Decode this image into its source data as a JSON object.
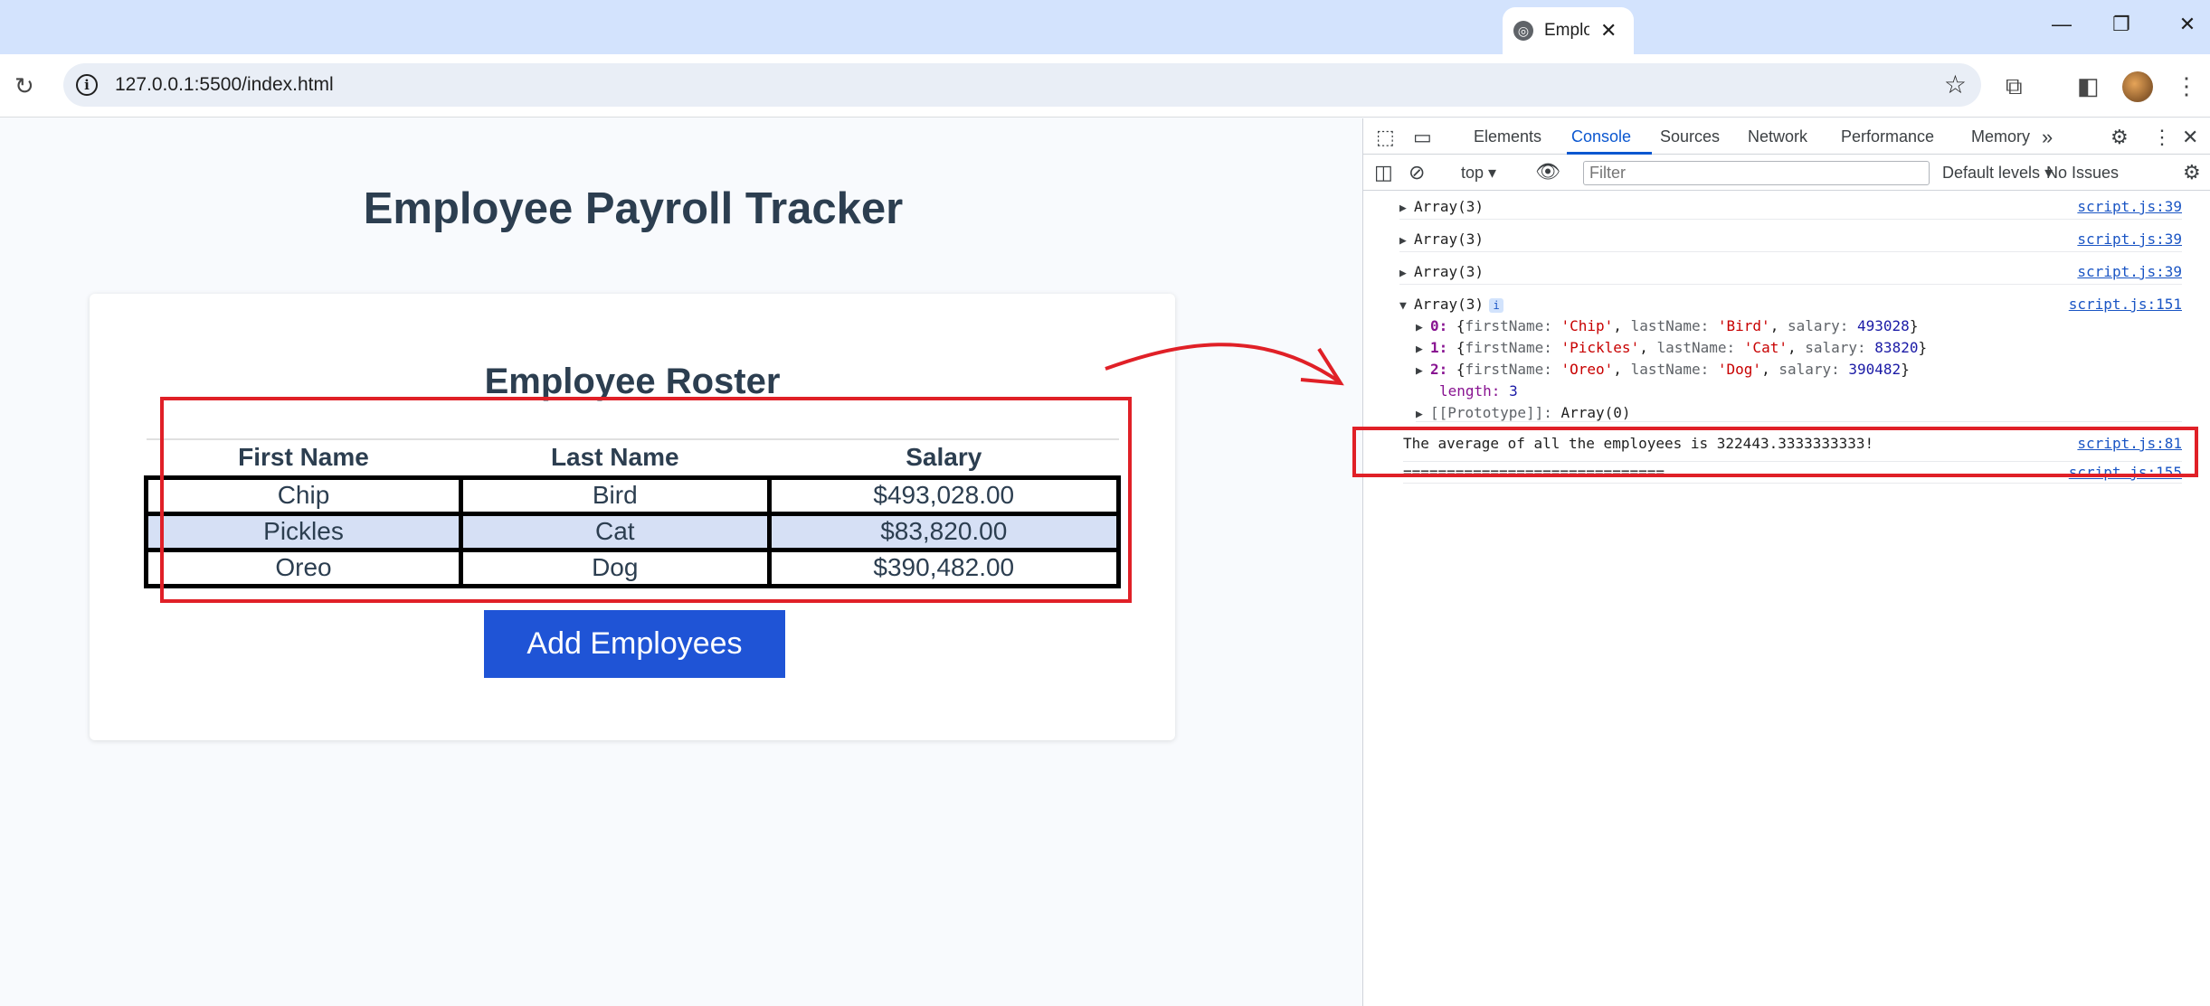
{
  "browser": {
    "tab_title": "Employee Payroll Tracker",
    "url": "127.0.0.1:5500/index.html"
  },
  "page": {
    "title": "Employee Payroll Tracker",
    "roster_title": "Employee Roster",
    "table": {
      "headers": [
        "First Name",
        "Last Name",
        "Salary"
      ],
      "rows": [
        [
          "Chip",
          "Bird",
          "$493,028.00"
        ],
        [
          "Pickles",
          "Cat",
          "$83,820.00"
        ],
        [
          "Oreo",
          "Dog",
          "$390,482.00"
        ]
      ]
    },
    "add_button_label": "Add Employees"
  },
  "devtools": {
    "tabs": [
      "Elements",
      "Console",
      "Sources",
      "Network",
      "Performance",
      "Memory"
    ],
    "active_tab": "Console",
    "context": "top",
    "filter_placeholder": "Filter",
    "levels_label": "Default levels",
    "issues_label": "No Issues",
    "console": {
      "collapsed_arrays": [
        {
          "label": "Array(3)",
          "source": "script.js:39"
        },
        {
          "label": "Array(3)",
          "source": "script.js:39"
        },
        {
          "label": "Array(3)",
          "source": "script.js:39"
        }
      ],
      "expanded_array": {
        "label": "Array(3)",
        "source": "script.js:151",
        "items": [
          {
            "index": "0:",
            "firstName": "'Chip'",
            "lastName": "'Bird'",
            "salary": "493028"
          },
          {
            "index": "1:",
            "firstName": "'Pickles'",
            "lastName": "'Cat'",
            "salary": "83820"
          },
          {
            "index": "2:",
            "firstName": "'Oreo'",
            "lastName": "'Dog'",
            "salary": "390482"
          }
        ],
        "length_label": "length:",
        "length_value": "3",
        "prototype_label": "[[Prototype]]:",
        "prototype_value": "Array(0)"
      },
      "average_message": "The average of all the employees is 322443.3333333333!",
      "average_source": "script.js:81",
      "separator": "==============================",
      "separator_source": "script.js:155"
    }
  },
  "colors": {
    "annotation": "#e02027",
    "button": "#1f54d6",
    "row_alt": "#d6e0f5"
  }
}
